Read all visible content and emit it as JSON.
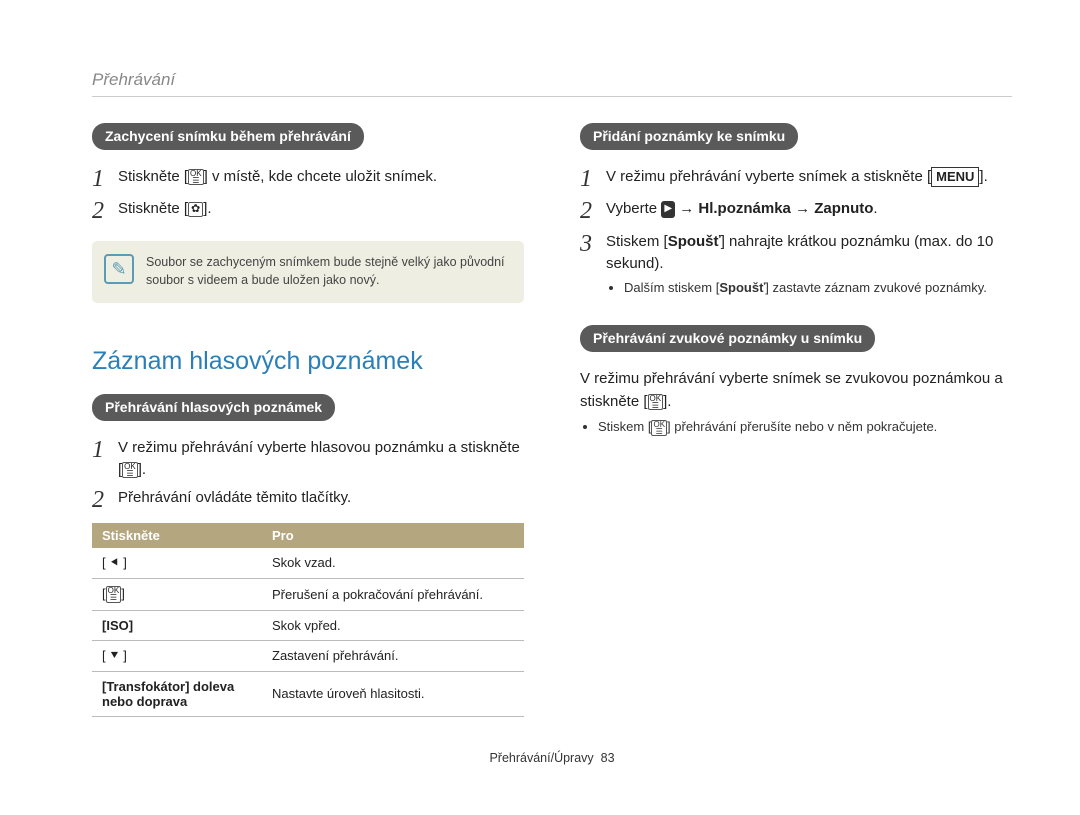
{
  "header": {
    "section": "Přehrávání"
  },
  "left": {
    "pill1": "Zachycení snímku během přehrávání",
    "step1a": "Stiskněte [",
    "step1b": "] v místě, kde chcete uložit snímek.",
    "step2a": "Stiskněte [",
    "step2b": "].",
    "note": "Soubor se zachyceným snímkem bude stejně velký jako původní soubor s videem a bude uložen jako nový.",
    "heading": "Záznam hlasových poznámek",
    "pill2": "Přehrávání hlasových poznámek",
    "vstep1a": "V režimu přehrávání vyberte hlasovou poznámku a stiskněte [",
    "vstep1b": "].",
    "vstep2": "Přehrávání ovládáte těmito tlačítky.",
    "table": {
      "h1": "Stiskněte",
      "h2": "Pro",
      "rows": [
        {
          "k": "[ ⯇ ]",
          "kType": "icon",
          "kName": "flash-icon",
          "v": "Skok vzad."
        },
        {
          "k": "[OK]",
          "kType": "ok",
          "kName": "ok-icon",
          "v": "Přerušení a pokračování přehrávání."
        },
        {
          "k": "[ISO]",
          "kType": "bold",
          "kName": "iso-label",
          "v": "Skok vpřed."
        },
        {
          "k": "[ ⯆ ]",
          "kType": "icon",
          "kName": "flower-icon",
          "v": "Zastavení přehrávání."
        },
        {
          "k": "[Transfokátor] doleva nebo doprava",
          "kType": "bold",
          "kName": "zoom-label",
          "v": "Nastavte úroveň hlasitosti."
        }
      ]
    }
  },
  "right": {
    "pill1": "Přidání poznámky ke snímku",
    "r1a": "V režimu přehrávání vyberte snímek a stiskněte [",
    "r1b": "].",
    "menu": "MENU",
    "r2a": "Vyberte ",
    "r2b_arrow": "→",
    "r2c": "Hl.poznámka",
    "r2d": "Zapnuto",
    "r3a": "Stiskem [",
    "r3b": "Spoušť",
    "r3c": "] nahrajte krátkou poznámku (max. do 10 sekund).",
    "bullet1a": "Dalším stiskem [",
    "bullet1b": "Spoušť",
    "bullet1c": "] zastavte záznam zvukové poznámky.",
    "pill2": "Přehrávání zvukové poznámky u snímku",
    "body1a": "V režimu přehrávání vyberte snímek se zvukovou poznámkou a stiskněte [",
    "body1b": "].",
    "bullet2a": "Stiskem [",
    "bullet2b": "] přehrávání přerušíte nebo v něm pokračujete."
  },
  "footer": {
    "text": "Přehrávání/Úpravy",
    "page": "83"
  },
  "icons": {
    "ok_top": "OK",
    "ok_bot": "☰",
    "flower": "✿",
    "chip": "▶"
  }
}
